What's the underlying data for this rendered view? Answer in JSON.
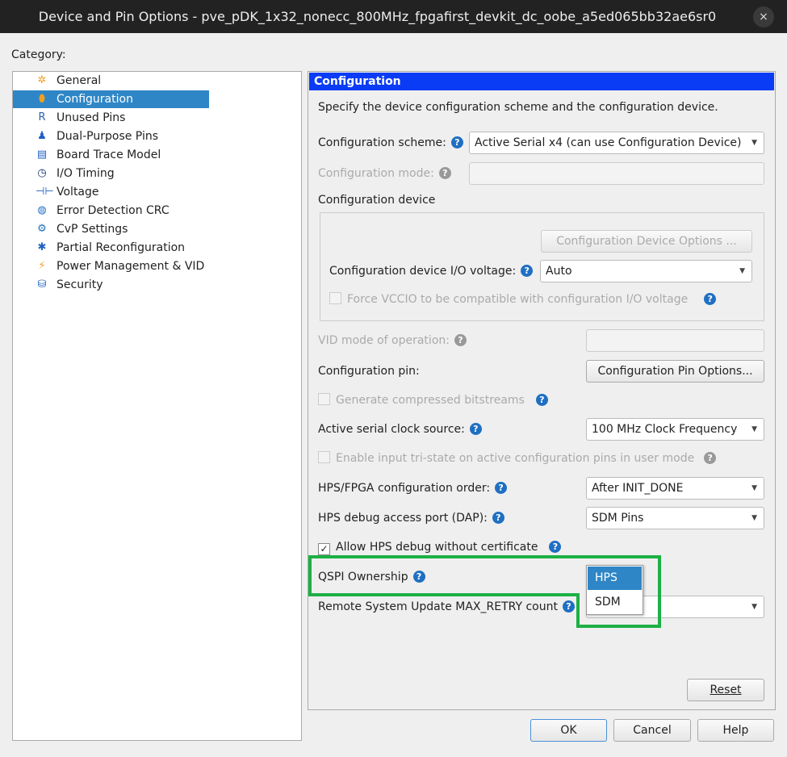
{
  "window": {
    "title": "Device and Pin Options - pve_pDK_1x32_nonecc_800MHz_fpgafirst_devkit_dc_oobe_a5ed065bb32ae6sr0",
    "close": "×"
  },
  "category_label": "Category:",
  "tree": [
    {
      "label": "General",
      "icon": "gear-star-icon",
      "glyph": "✲",
      "color": "#f0a020"
    },
    {
      "label": "Configuration",
      "icon": "configuration-icon",
      "glyph": "⬮",
      "color": "#ffffff"
    },
    {
      "label": "Unused Pins",
      "icon": "unused-pins-icon",
      "glyph": "R",
      "color": "#3060b0"
    },
    {
      "label": "Dual-Purpose Pins",
      "icon": "dual-purpose-pins-icon",
      "glyph": "♟",
      "color": "#2060c0"
    },
    {
      "label": "Board Trace Model",
      "icon": "board-trace-icon",
      "glyph": "▤",
      "color": "#2060c0"
    },
    {
      "label": "I/O Timing",
      "icon": "clock-icon",
      "glyph": "◷",
      "color": "#103070"
    },
    {
      "label": "Voltage",
      "icon": "voltage-icon",
      "glyph": "⊣⊢",
      "color": "#2060c0"
    },
    {
      "label": "Error Detection CRC",
      "icon": "globe-icon",
      "glyph": "◍",
      "color": "#2070c0"
    },
    {
      "label": "CvP Settings",
      "icon": "cvp-icon",
      "glyph": "⚙",
      "color": "#2070c0"
    },
    {
      "label": "Partial Reconfiguration",
      "icon": "partial-reconfig-icon",
      "glyph": "✱",
      "color": "#2060c0"
    },
    {
      "label": "Power Management & VID",
      "icon": "power-icon",
      "glyph": "⚡",
      "color": "#f0a020"
    },
    {
      "label": "Security",
      "icon": "security-icon",
      "glyph": "⛁",
      "color": "#2060c0"
    }
  ],
  "panel": {
    "header": "Configuration",
    "description": "Specify the device configuration scheme and the configuration device.",
    "scheme_label": "Configuration scheme:",
    "scheme_value": "Active Serial x4 (can use Configuration Device)",
    "mode_label": "Configuration mode:",
    "device_label": "Configuration device",
    "device_options_button": "Configuration Device Options ...",
    "io_voltage_label": "Configuration device I/O voltage:",
    "io_voltage_value": "Auto",
    "force_vccio_label": "Force VCCIO to be compatible with configuration I/O voltage",
    "vid_label": "VID mode of operation:",
    "pin_label": "Configuration pin:",
    "pin_button": "Configuration Pin Options...",
    "compressed_label": "Generate compressed bitstreams",
    "clock_label": "Active serial clock source:",
    "clock_value": "100 MHz Clock Frequency",
    "tristate_label": "Enable input tri-state on active configuration pins in user mode",
    "order_label": "HPS/FPGA configuration order:",
    "order_value": "After INIT_DONE",
    "dap_label": "HPS debug access port (DAP):",
    "dap_value": "SDM Pins",
    "allow_debug_label": "Allow HPS debug without certificate",
    "allow_debug_checked": true,
    "qspi_label": "QSPI Ownership",
    "qspi_options": [
      "HPS",
      "SDM"
    ],
    "qspi_highlighted": "HPS",
    "rsu_label": "Remote System Update MAX_RETRY count",
    "reset_button": "Reset"
  },
  "help_glyph": "?",
  "check_glyph": "✓",
  "arrow_glyph": "▼",
  "buttons": {
    "ok": "OK",
    "cancel": "Cancel",
    "help": "Help"
  },
  "colors": {
    "highlight": "#2f86c6",
    "header": "#0a3cf5",
    "annotation": "#1db045"
  }
}
